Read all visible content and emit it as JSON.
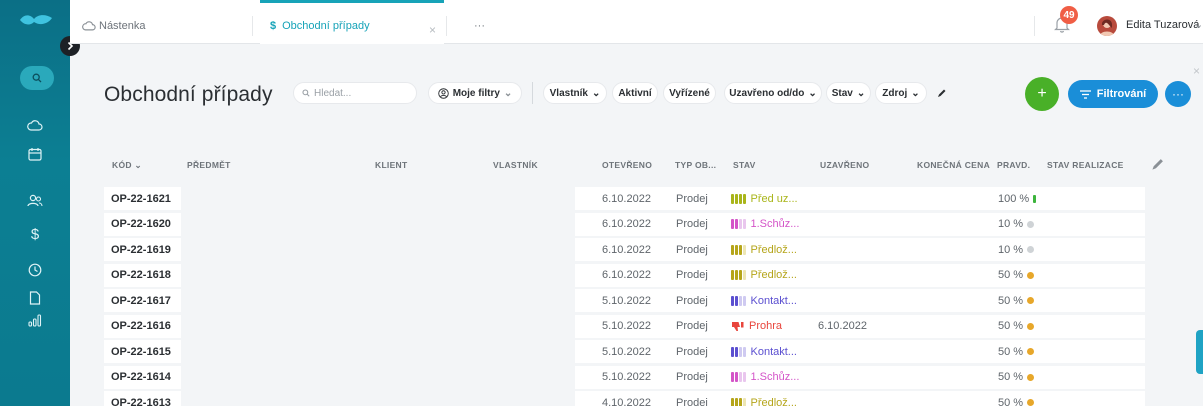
{
  "colors": {
    "sidebar": "#0b7a8f",
    "accent_teal": "#17a3b8",
    "green": "#49b028",
    "blue": "#1a8ed8",
    "badge_red": "#f05e45"
  },
  "sidebar": {
    "expand_icon": "chevron-right-icon",
    "items": [
      {
        "icon": "search-icon"
      },
      {
        "icon": "cloud-icon"
      },
      {
        "icon": "calendar-icon"
      },
      {
        "icon": "users-icon"
      },
      {
        "icon": "dollar-icon"
      },
      {
        "icon": "clock-icon"
      },
      {
        "icon": "document-icon"
      },
      {
        "icon": "bar-chart-icon"
      }
    ]
  },
  "tabs": [
    {
      "label": "Nástenka",
      "icon": "cloud-icon",
      "active": false
    },
    {
      "label": "Obchodní případy",
      "icon": "dollar-icon",
      "active": true,
      "close": "×"
    },
    {
      "label": "···",
      "active": false
    }
  ],
  "user": {
    "notifications": "49",
    "name": "Edita Tuzarová",
    "chevron": "⌄"
  },
  "header": {
    "title": "Obchodní případy",
    "search_placeholder": "Hledat...",
    "my_filters": "Moje filtry",
    "filters": [
      "Vlastník",
      "Aktivní",
      "Vyřízené",
      "Uzavřeno od/do",
      "Stav",
      "Zdroj"
    ],
    "add_button": "+",
    "filter_button": "Filtrování",
    "more_button": "···",
    "close_panel": "×"
  },
  "table": {
    "columns": [
      "KÓD",
      "PŘEDMĚT",
      "KLIENT",
      "VLASTNÍK",
      "OTEVŘENO",
      "TYP OB...",
      "STAV",
      "UZAVŘENO",
      "KONEČNÁ CENA",
      "PRAVD.",
      "STAV REALIZACE"
    ],
    "sort_indicator": "⌄",
    "rows": [
      {
        "code": "OP-22-1621",
        "opened": "6.10.2022",
        "type": "Prodej",
        "status": "Před uz...",
        "status_color": "#a9b51a",
        "bars": [
          "#a9b51a",
          "#a9b51a",
          "#a9b51a",
          "#a9b51a"
        ],
        "closed": "",
        "prob": "100 %",
        "prob_marker": "bar",
        "prob_color": "#3cb43c"
      },
      {
        "code": "OP-22-1620",
        "opened": "6.10.2022",
        "type": "Prodej",
        "status": "1.Schůz...",
        "status_color": "#d454c8",
        "bars": [
          "#d454c8",
          "#d454c8",
          "#e9c6ee",
          "#e9c6ee"
        ],
        "closed": "",
        "prob": "10 %",
        "prob_marker": "dot",
        "prob_color": "#cfd3d6"
      },
      {
        "code": "OP-22-1619",
        "opened": "6.10.2022",
        "type": "Prodej",
        "status": "Předlož...",
        "status_color": "#b5a51a",
        "bars": [
          "#b5a51a",
          "#b5a51a",
          "#b5a51a",
          "#ede6b4"
        ],
        "closed": "",
        "prob": "10 %",
        "prob_marker": "dot",
        "prob_color": "#cfd3d6"
      },
      {
        "code": "OP-22-1618",
        "opened": "6.10.2022",
        "type": "Prodej",
        "status": "Předlož...",
        "status_color": "#b5a51a",
        "bars": [
          "#b5a51a",
          "#b5a51a",
          "#b5a51a",
          "#ede6b4"
        ],
        "closed": "",
        "prob": "50 %",
        "prob_marker": "dot",
        "prob_color": "#e7a72a"
      },
      {
        "code": "OP-22-1617",
        "opened": "5.10.2022",
        "type": "Prodej",
        "status": "Kontakt...",
        "status_color": "#5b4fd0",
        "bars": [
          "#5b4fd0",
          "#5b4fd0",
          "#cfcaf1",
          "#cfcaf1"
        ],
        "closed": "",
        "prob": "50 %",
        "prob_marker": "dot",
        "prob_color": "#e7a72a"
      },
      {
        "code": "OP-22-1616",
        "opened": "5.10.2022",
        "type": "Prodej",
        "status": "Prohra",
        "status_color": "#e8453c",
        "lost": true,
        "closed": "6.10.2022",
        "prob": "50 %",
        "prob_marker": "dot",
        "prob_color": "#e7a72a"
      },
      {
        "code": "OP-22-1615",
        "opened": "5.10.2022",
        "type": "Prodej",
        "status": "Kontakt...",
        "status_color": "#5b4fd0",
        "bars": [
          "#5b4fd0",
          "#5b4fd0",
          "#cfcaf1",
          "#cfcaf1"
        ],
        "closed": "",
        "prob": "50 %",
        "prob_marker": "dot",
        "prob_color": "#e7a72a"
      },
      {
        "code": "OP-22-1614",
        "opened": "5.10.2022",
        "type": "Prodej",
        "status": "1.Schůz...",
        "status_color": "#d454c8",
        "bars": [
          "#d454c8",
          "#d454c8",
          "#e9c6ee",
          "#e9c6ee"
        ],
        "closed": "",
        "prob": "50 %",
        "prob_marker": "dot",
        "prob_color": "#e7a72a"
      },
      {
        "code": "OP-22-1613",
        "opened": "4.10.2022",
        "type": "Prodej",
        "status": "Předlož...",
        "status_color": "#b5a51a",
        "bars": [
          "#b5a51a",
          "#b5a51a",
          "#b5a51a",
          "#ede6b4"
        ],
        "closed": "",
        "prob": "50 %",
        "prob_marker": "dot",
        "prob_color": "#e7a72a"
      }
    ]
  }
}
